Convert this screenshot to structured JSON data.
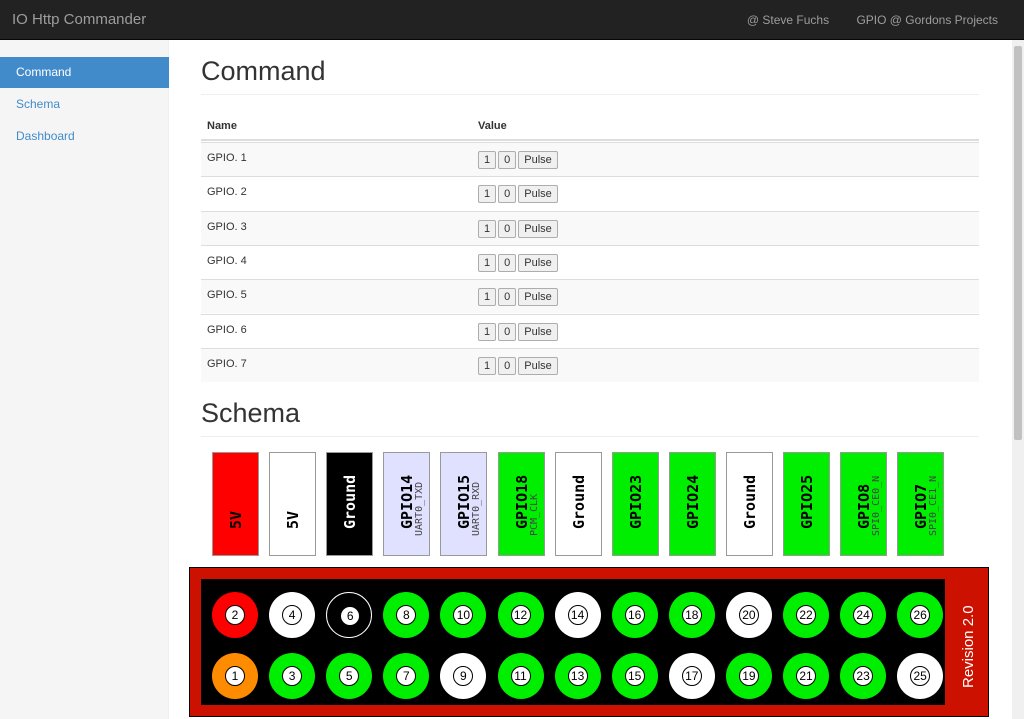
{
  "navbar": {
    "brand": "IO Http Commander",
    "links": [
      "@ Steve Fuchs",
      "GPIO @ Gordons Projects"
    ]
  },
  "sidebar": {
    "items": [
      {
        "label": "Command",
        "active": true
      },
      {
        "label": "Schema",
        "active": false
      },
      {
        "label": "Dashboard",
        "active": false
      }
    ]
  },
  "command": {
    "title": "Command",
    "headers": {
      "name": "Name",
      "value": "Value"
    },
    "rows": [
      {
        "name": "GPIO. 1"
      },
      {
        "name": "GPIO. 2"
      },
      {
        "name": "GPIO. 3"
      },
      {
        "name": "GPIO. 4"
      },
      {
        "name": "GPIO. 5"
      },
      {
        "name": "GPIO. 6"
      },
      {
        "name": "GPIO. 7"
      }
    ],
    "buttons": {
      "on": "1",
      "off": "0",
      "pulse": "Pulse"
    }
  },
  "schema": {
    "title": "Schema",
    "labels": [
      {
        "name": "5V",
        "sub": "",
        "bg": "#ff0000"
      },
      {
        "name": "5V",
        "sub": "",
        "bg": "#ffffff"
      },
      {
        "name": "Ground",
        "sub": "",
        "bg": "#000000",
        "fg": "#ffffff"
      },
      {
        "name": "GPIO14",
        "sub": "UART0_TXD",
        "bg": "#e0e0ff"
      },
      {
        "name": "GPIO15",
        "sub": "UART0_RXD",
        "bg": "#e0e0ff"
      },
      {
        "name": "GPIO18",
        "sub": "PCM_CLK",
        "bg": "#00ee00"
      },
      {
        "name": "Ground",
        "sub": "",
        "bg": "#ffffff"
      },
      {
        "name": "GPIO23",
        "sub": "",
        "bg": "#00ee00"
      },
      {
        "name": "GPIO24",
        "sub": "",
        "bg": "#00ee00"
      },
      {
        "name": "Ground",
        "sub": "",
        "bg": "#ffffff"
      },
      {
        "name": "GPIO25",
        "sub": "",
        "bg": "#00ee00"
      },
      {
        "name": "GPIO8",
        "sub": "SPI0_CE0_N",
        "bg": "#00ee00"
      },
      {
        "name": "GPIO7",
        "sub": "SPI0_CE1_N",
        "bg": "#00ee00"
      }
    ],
    "top_pins": [
      {
        "n": "2",
        "color": "#ff0000"
      },
      {
        "n": "4",
        "color": "#ffffff"
      },
      {
        "n": "6",
        "color": "#000000"
      },
      {
        "n": "8",
        "color": "#00ee00"
      },
      {
        "n": "10",
        "color": "#00ee00"
      },
      {
        "n": "12",
        "color": "#00ee00"
      },
      {
        "n": "14",
        "color": "#ffffff"
      },
      {
        "n": "16",
        "color": "#00ee00"
      },
      {
        "n": "18",
        "color": "#00ee00"
      },
      {
        "n": "20",
        "color": "#ffffff"
      },
      {
        "n": "22",
        "color": "#00ee00"
      },
      {
        "n": "24",
        "color": "#00ee00"
      },
      {
        "n": "26",
        "color": "#00ee00"
      }
    ],
    "bottom_pins": [
      {
        "n": "1",
        "color": "#ff8c00"
      },
      {
        "n": "3",
        "color": "#00ee00"
      },
      {
        "n": "5",
        "color": "#00ee00"
      },
      {
        "n": "7",
        "color": "#00ee00"
      },
      {
        "n": "9",
        "color": "#ffffff"
      },
      {
        "n": "11",
        "color": "#00ee00"
      },
      {
        "n": "13",
        "color": "#00ee00"
      },
      {
        "n": "15",
        "color": "#00ee00"
      },
      {
        "n": "17",
        "color": "#ffffff"
      },
      {
        "n": "19",
        "color": "#00ee00"
      },
      {
        "n": "21",
        "color": "#00ee00"
      },
      {
        "n": "23",
        "color": "#00ee00"
      },
      {
        "n": "25",
        "color": "#ffffff"
      }
    ],
    "revision": "Revision 2.0"
  }
}
